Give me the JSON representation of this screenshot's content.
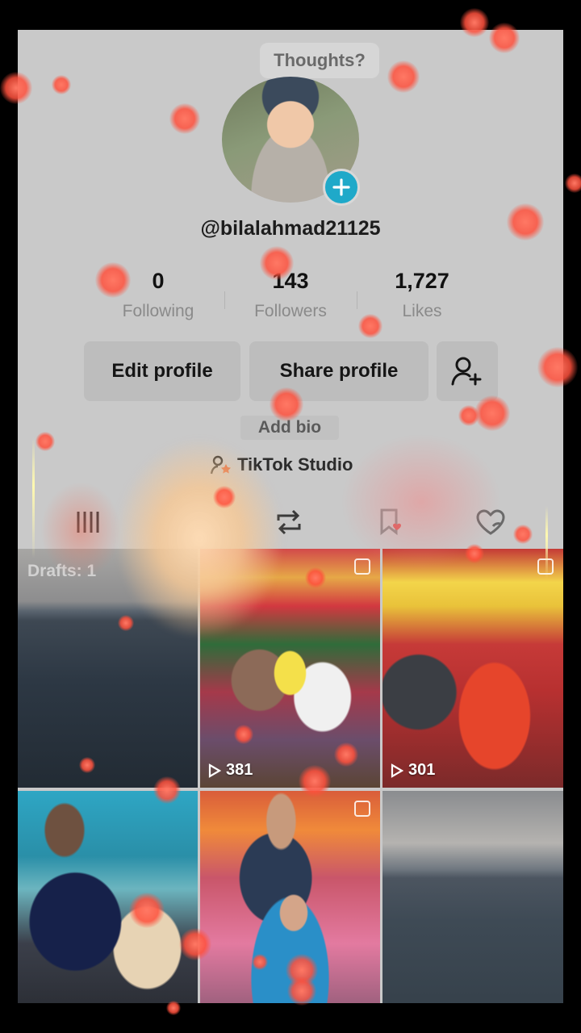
{
  "profile": {
    "thoughts_prompt": "Thoughts?",
    "username": "@bilalahmad21125",
    "add_bio": "Add bio",
    "studio_label": "TikTok Studio"
  },
  "stats": [
    {
      "value": "0",
      "label": "Following"
    },
    {
      "value": "143",
      "label": "Followers"
    },
    {
      "value": "1,727",
      "label": "Likes"
    }
  ],
  "buttons": {
    "edit_profile": "Edit profile",
    "share_profile": "Share profile"
  },
  "tabs": [
    {
      "icon": "grid-icon",
      "selected": true
    },
    {
      "icon": "repost-icon"
    },
    {
      "icon": "bookmark-icon"
    },
    {
      "icon": "liked-heart-icon"
    }
  ],
  "videos": [
    {
      "label": "Drafts: 1",
      "views": ""
    },
    {
      "views": "381"
    },
    {
      "views": "301"
    },
    {
      "views": ""
    },
    {
      "views": ""
    },
    {
      "views": ""
    }
  ],
  "colors": {
    "accent": "#1fa9c9",
    "background": "#c9c9c9",
    "particles": "#ff6a55"
  }
}
